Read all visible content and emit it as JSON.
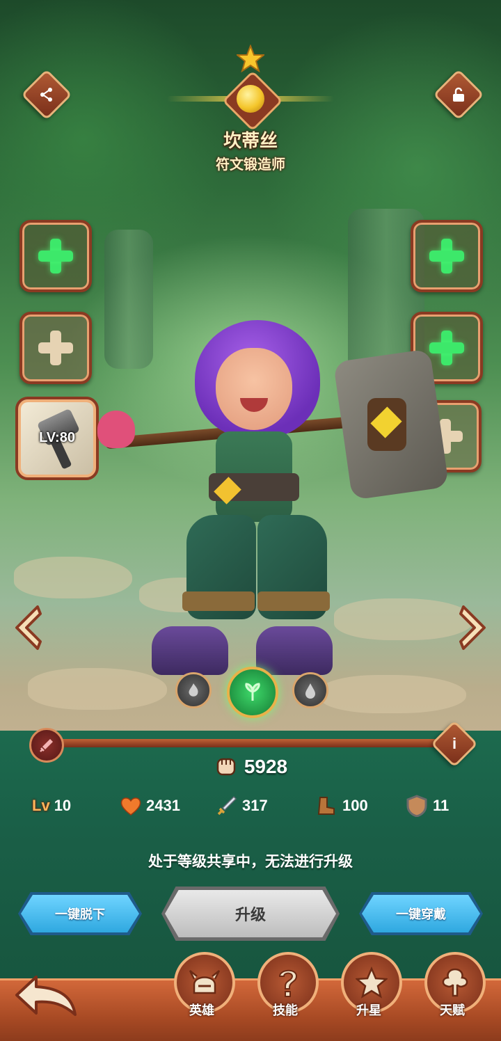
{
  "hero": {
    "name": "坎蒂丝",
    "title": "符文锻造师"
  },
  "weapon_slot": {
    "level_label": "LV:80"
  },
  "power": {
    "value": "5928"
  },
  "stats": [
    {
      "icon": "level-badge-icon",
      "label": "Lv",
      "value": "10"
    },
    {
      "icon": "heart-icon",
      "value": "2431"
    },
    {
      "icon": "sword-icon",
      "value": "317"
    },
    {
      "icon": "boot-icon",
      "value": "100"
    },
    {
      "icon": "shield-icon",
      "value": "11"
    }
  ],
  "notice": "处于等级共享中，无法进行升级",
  "buttons": {
    "unequip_all": "一键脱下",
    "upgrade": "升级",
    "equip_all": "一键穿戴"
  },
  "nav": [
    {
      "icon": "helmet-icon",
      "label": "英雄"
    },
    {
      "icon": "question-icon",
      "label": "技能"
    },
    {
      "icon": "star-icon",
      "label": "升星"
    },
    {
      "icon": "tree-icon",
      "label": "天赋"
    }
  ],
  "colors": {
    "accent_green": "#3de86a",
    "button_blue": "#34b6e8",
    "frame_brown": "#8a3a22",
    "gold": "#f2c230"
  }
}
